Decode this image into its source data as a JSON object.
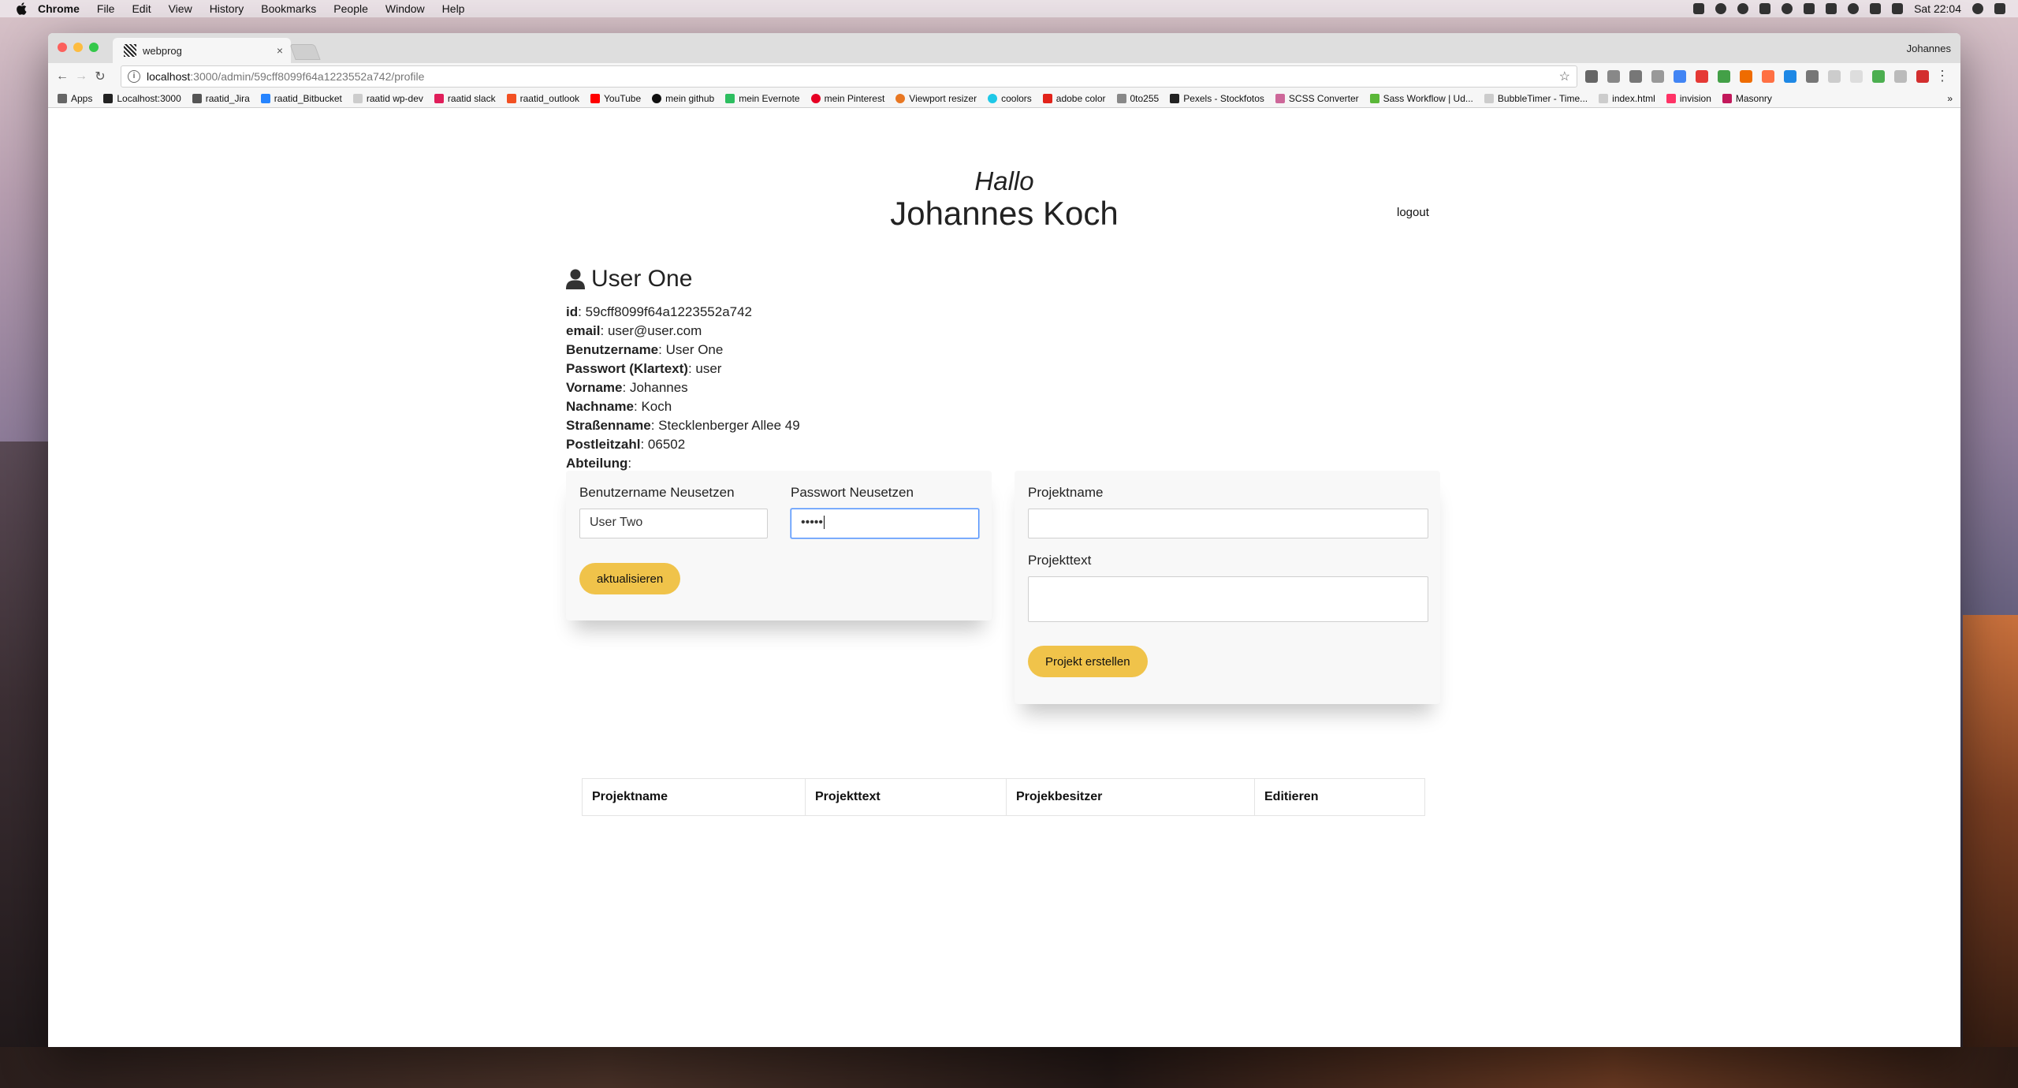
{
  "menubar": {
    "app": "Chrome",
    "items": [
      "File",
      "Edit",
      "View",
      "History",
      "Bookmarks",
      "People",
      "Window",
      "Help"
    ],
    "clock": "Sat 22:04"
  },
  "browser": {
    "tab_title": "webprog",
    "tab_close": "×",
    "profile": "Johannes",
    "url_host": "localhost",
    "url_path": ":3000/admin/59cff8099f64a1223552a742/profile",
    "bookmarks": [
      {
        "label": "Apps",
        "color": "#666"
      },
      {
        "label": "Localhost:3000",
        "color": "#222"
      },
      {
        "label": "raatid_Jira",
        "color": "#555"
      },
      {
        "label": "raatid_Bitbucket",
        "color": "#2684ff"
      },
      {
        "label": "raatid wp-dev",
        "color": "#999"
      },
      {
        "label": "raatid slack",
        "color": "#e01e5a"
      },
      {
        "label": "raatid_outlook",
        "color": "#f25022"
      },
      {
        "label": "YouTube",
        "color": "#ff0000"
      },
      {
        "label": "mein github",
        "color": "#111"
      },
      {
        "label": "mein Evernote",
        "color": "#2dbe60"
      },
      {
        "label": "mein Pinterest",
        "color": "#e60023"
      },
      {
        "label": "Viewport resizer",
        "color": "#e87722"
      },
      {
        "label": "coolors",
        "color": "#1ec8e7"
      },
      {
        "label": "adobe color",
        "color": "#e2231a"
      },
      {
        "label": "0to255",
        "color": "#888"
      },
      {
        "label": "Pexels - Stockfotos",
        "color": "#222"
      },
      {
        "label": "SCSS Converter",
        "color": "#cd6799"
      },
      {
        "label": "Sass Workflow | Ud...",
        "color": "#5ab738"
      },
      {
        "label": "BubbleTimer - Time...",
        "color": "#999"
      },
      {
        "label": "index.html",
        "color": "#999"
      },
      {
        "label": "invision",
        "color": "#ff3366"
      },
      {
        "label": "Masonry",
        "color": "#c2185b"
      }
    ],
    "bookmarks_more": "»"
  },
  "header": {
    "greeting": "Hallo",
    "name": "Johannes Koch",
    "logout": "logout"
  },
  "user": {
    "title": "User One",
    "fields": [
      {
        "label": "id",
        "value": "59cff8099f64a1223552a742"
      },
      {
        "label": "email",
        "value": "user@user.com"
      },
      {
        "label": "Benutzername",
        "value": "User One"
      },
      {
        "label": "Passwort (Klartext)",
        "value": "user"
      },
      {
        "label": "Vorname",
        "value": "Johannes"
      },
      {
        "label": "Nachname",
        "value": "Koch"
      },
      {
        "label": "Straßenname",
        "value": "Stecklenberger Allee 49"
      },
      {
        "label": "Postleitzahl",
        "value": "06502"
      },
      {
        "label": "Abteilung",
        "value": ""
      }
    ]
  },
  "reset_form": {
    "username_label": "Benutzername Neusetzen",
    "username_value": "User Two",
    "password_label": "Passwort Neusetzen",
    "password_value": "•••••",
    "submit": "aktualisieren"
  },
  "project_form": {
    "name_label": "Projektname",
    "text_label": "Projekttext",
    "submit": "Projekt erstellen"
  },
  "projects_table": {
    "headers": [
      "Projektname",
      "Projekttext",
      "Projekbesitzer",
      "Editieren"
    ]
  }
}
